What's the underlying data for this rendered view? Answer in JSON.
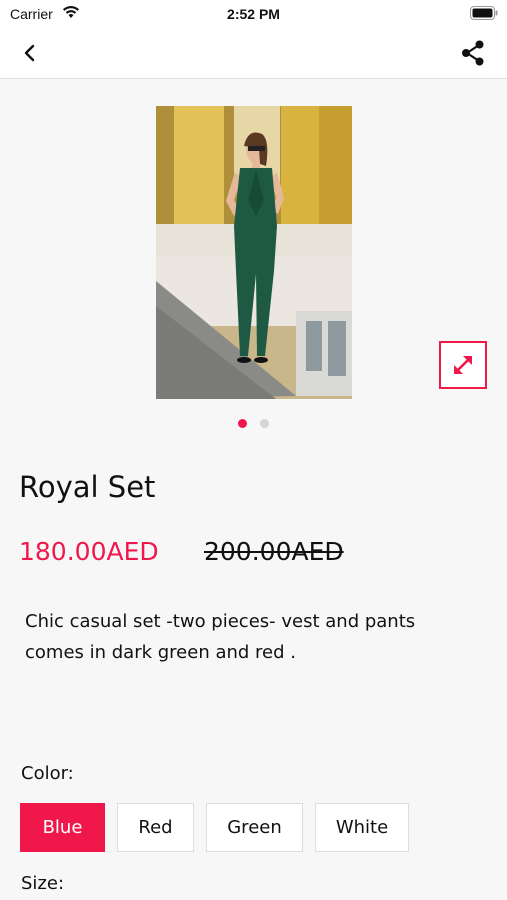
{
  "status_bar": {
    "carrier": "Carrier",
    "time": "2:52 PM"
  },
  "nav": {
    "back_icon": "chevron-left-icon",
    "share_icon": "share-icon"
  },
  "gallery": {
    "pages": 2,
    "active_page": 1,
    "expand_icon": "expand-arrows-icon"
  },
  "product": {
    "title": "Royal Set",
    "price": "180.00AED",
    "old_price": "200.00AED",
    "description": "Chic casual set -two pieces- vest and pants comes in dark green and red ."
  },
  "color": {
    "label": "Color:",
    "selected": "Blue",
    "options": [
      {
        "label": "Blue"
      },
      {
        "label": "Red"
      },
      {
        "label": "Green"
      },
      {
        "label": "White"
      }
    ]
  },
  "size": {
    "label": "Size:"
  },
  "colors": {
    "accent": "#f0174b",
    "background": "#f7f7f7",
    "suit": "#1e5a43"
  }
}
